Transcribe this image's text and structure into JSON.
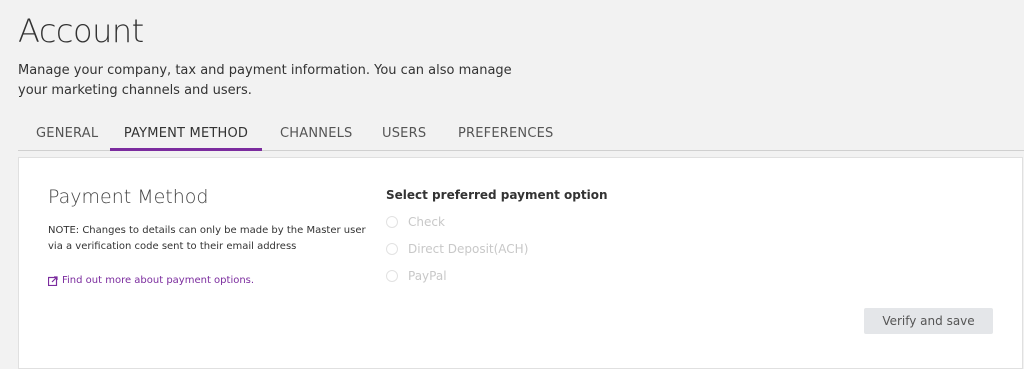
{
  "header": {
    "title": "Account",
    "description": "Manage your company, tax and payment information. You can also manage your marketing channels and users."
  },
  "tabs": [
    {
      "label": "GENERAL",
      "active": false
    },
    {
      "label": "PAYMENT METHOD",
      "active": true
    },
    {
      "label": "CHANNELS",
      "active": false
    },
    {
      "label": "USERS",
      "active": false
    },
    {
      "label": "PREFERENCES",
      "active": false
    }
  ],
  "payment": {
    "title": "Payment Method",
    "note": "NOTE: Changes to details can only be made by the Master user via a verification code sent to their email address",
    "link_label": "Find out more about payment options.",
    "link_icon": "external-link-icon",
    "option_title": "Select preferred payment option",
    "options": [
      {
        "label": "Check",
        "selected": false
      },
      {
        "label": "Direct Deposit(ACH)",
        "selected": false
      },
      {
        "label": "PayPal",
        "selected": false
      }
    ],
    "verify_label": "Verify and save"
  },
  "colors": {
    "accent": "#7b2c9e",
    "background": "#f2f2f2",
    "disabled_text": "#c8c8c8"
  }
}
